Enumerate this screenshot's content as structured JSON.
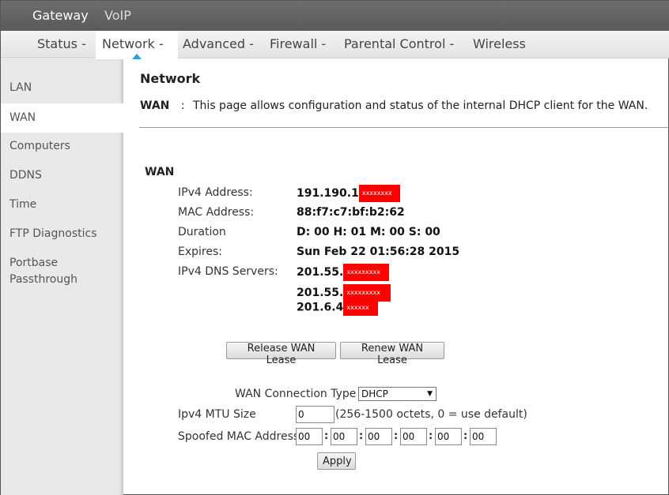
{
  "topbar": {
    "tabs": [
      {
        "label": "Gateway"
      },
      {
        "label": "VoIP"
      }
    ]
  },
  "menubar": {
    "items": [
      {
        "label": "Status -"
      },
      {
        "label": "Network -"
      },
      {
        "label": "Advanced -"
      },
      {
        "label": "Firewall -"
      },
      {
        "label": "Parental Control -"
      },
      {
        "label": "Wireless"
      }
    ]
  },
  "sidebar": {
    "items": [
      {
        "label": "LAN"
      },
      {
        "label": "WAN"
      },
      {
        "label": "Computers"
      },
      {
        "label": "DDNS"
      },
      {
        "label": "Time"
      },
      {
        "label": "FTP Diagnostics"
      },
      {
        "label": "Portbase Passthrough"
      }
    ]
  },
  "page": {
    "title": "Network",
    "desc_key": "WAN",
    "desc_sep": ":",
    "desc_text": "This page allows configuration and status of the internal DHCP client for the WAN.",
    "section": "WAN"
  },
  "status": {
    "ipv4_label": "IPv4 Address:",
    "ipv4_value": "191.190.1",
    "ipv4_redacted": "xxxxxxxx",
    "mac_label": "MAC Address:",
    "mac_value": "88:f7:c7:bf:b2:62",
    "duration_label": "Duration",
    "duration_value": "D: 00 H: 01 M: 00 S: 00",
    "expires_label": "Expires:",
    "expires_value": "Sun Feb 22 01:56:28 2015",
    "dns_label": "IPv4 DNS Servers:",
    "dns": [
      {
        "value": "201.55.",
        "redacted": "xxxxxxxxx"
      },
      {
        "value": "201.55.",
        "redacted": "xxxxxxxxx"
      },
      {
        "value": "201.6.4",
        "redacted": "xxxxxx"
      }
    ]
  },
  "buttons": {
    "release": "Release WAN Lease",
    "renew": "Renew WAN Lease",
    "apply": "Apply"
  },
  "config": {
    "conn_type_label": "WAN Connection Type",
    "conn_type_value": "DHCP",
    "mtu_label": "Ipv4 MTU Size",
    "mtu_value": "0",
    "mtu_hint": "(256-1500 octets, 0 = use default)",
    "mac_label": "Spoofed MAC Address",
    "mac_octets": [
      "00",
      "00",
      "00",
      "00",
      "00",
      "00"
    ],
    "mac_sep": ":"
  }
}
